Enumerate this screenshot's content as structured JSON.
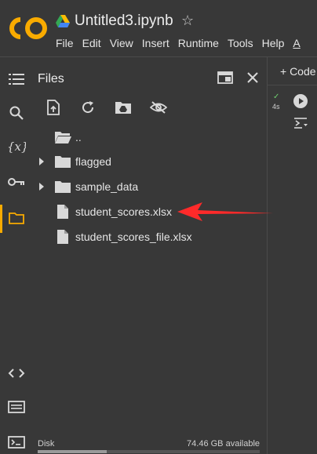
{
  "app": {
    "logo_text": "CO",
    "notebook_title": "Untitled3.ipynb"
  },
  "menu": [
    "File",
    "Edit",
    "View",
    "Insert",
    "Runtime",
    "Tools",
    "Help",
    "A"
  ],
  "files_panel": {
    "title": "Files",
    "tree": [
      {
        "type": "parent",
        "label": ".."
      },
      {
        "type": "folder",
        "label": "flagged"
      },
      {
        "type": "folder",
        "label": "sample_data"
      },
      {
        "type": "file",
        "label": "student_scores.xlsx"
      },
      {
        "type": "file",
        "label": "student_scores_file.xlsx"
      }
    ],
    "disk": {
      "label": "Disk",
      "available": "74.46 GB available",
      "used_fraction": 0.31
    }
  },
  "editor": {
    "add_code_label": "+ Code",
    "cell_time": "4s",
    "cell_check": "✓"
  },
  "colors": {
    "accent": "#f9ab00",
    "arrow": "#ff2a2a",
    "background": "#383838"
  }
}
